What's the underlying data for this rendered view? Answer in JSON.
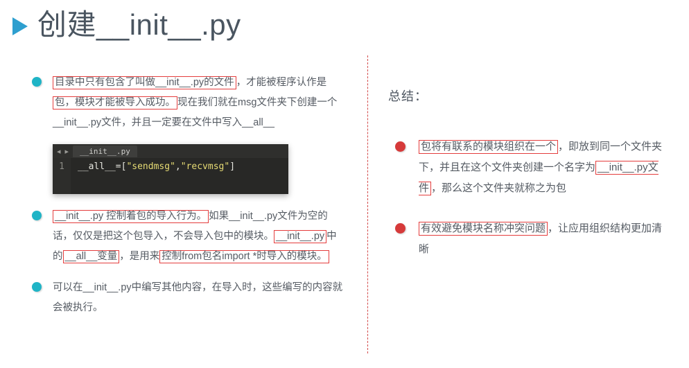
{
  "title": "创建__init__.py",
  "left": {
    "p1": {
      "hl1": "目录中只有包含了叫做__init__.py的文件",
      "mid1": "，才能被程序认作是 ",
      "hl2": "包，模块才能被导入成功。",
      "tail": "现在我们就在msg文件夹下创建一个__init__.py文件，并且一定要在文件中写入__all__"
    },
    "editor": {
      "tab": "__init__.py",
      "line_no": "1",
      "code_var": "__all__",
      "code_eq": "=",
      "code_lb": "[",
      "code_s1": "\"sendmsg\"",
      "code_comma": ",",
      "code_s2": "\"recvmsg\"",
      "code_rb": "]"
    },
    "p2": {
      "hl1": "__init__.py 控制着包的导入行为。",
      "mid1": "如果__init__.py文件为空的话，仅仅是把这个包导入，不会导入包中的模块。",
      "hl2": "__init__.py",
      "mid2": "中的",
      "hl3": "__all__变量",
      "mid3": "，是用来",
      "hl4": "控制from包名import *时导入的模块。"
    },
    "p3": "可以在__init__.py中编写其他内容，在导入时，这些编写的内容就会被执行。"
  },
  "right": {
    "title": "总结：",
    "b1": {
      "hl1": "包将有联系的模块组织在一个",
      "mid1": "，即放到同一个文件夹下，并且在这个文件夹创建一个名字为",
      "hl2": "__init__.py文件",
      "tail": "，那么这个文件夹就称之为包"
    },
    "b2": {
      "hl1": "有效避免模块名称冲突问题",
      "tail": "，让应用组织结构更加清晰"
    }
  }
}
